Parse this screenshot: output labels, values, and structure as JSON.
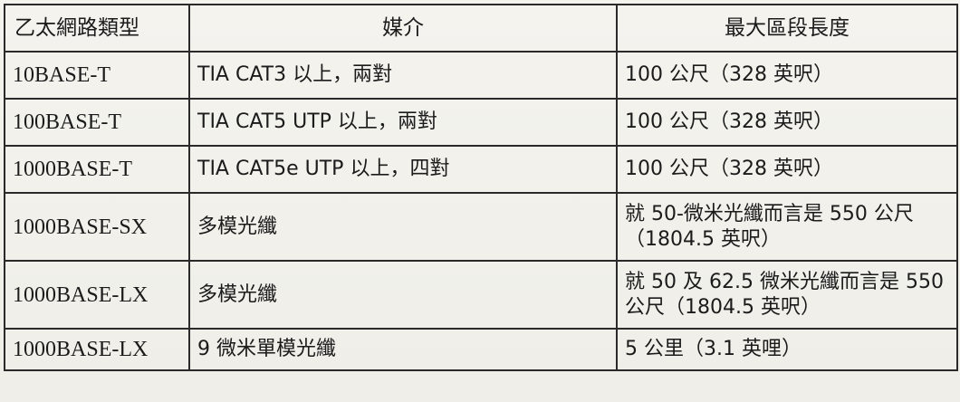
{
  "table": {
    "headers": [
      "乙太網路類型",
      "媒介",
      "最大區段長度"
    ],
    "rows": [
      {
        "type": "10BASE-T",
        "media": "TIA CAT3 以上，兩對",
        "length": "100 公尺（328 英呎）"
      },
      {
        "type": "100BASE-T",
        "media": "TIA CAT5 UTP 以上，兩對",
        "length": "100 公尺（328 英呎）"
      },
      {
        "type": "1000BASE-T",
        "media": "TIA CAT5e UTP 以上，四對",
        "length": "100 公尺（328 英呎）"
      },
      {
        "type": "1000BASE-SX",
        "media": "多模光纖",
        "length": "就 50-微米光纖而言是 550 公尺（1804.5 英呎）"
      },
      {
        "type": "1000BASE-LX",
        "media": "多模光纖",
        "length": "就 50 及 62.5 微米光纖而言是 550 公尺（1804.5 英呎）"
      },
      {
        "type": "1000BASE-LX",
        "media": "9 微米單模光纖",
        "length": "5 公里（3.1 英哩）"
      }
    ]
  }
}
